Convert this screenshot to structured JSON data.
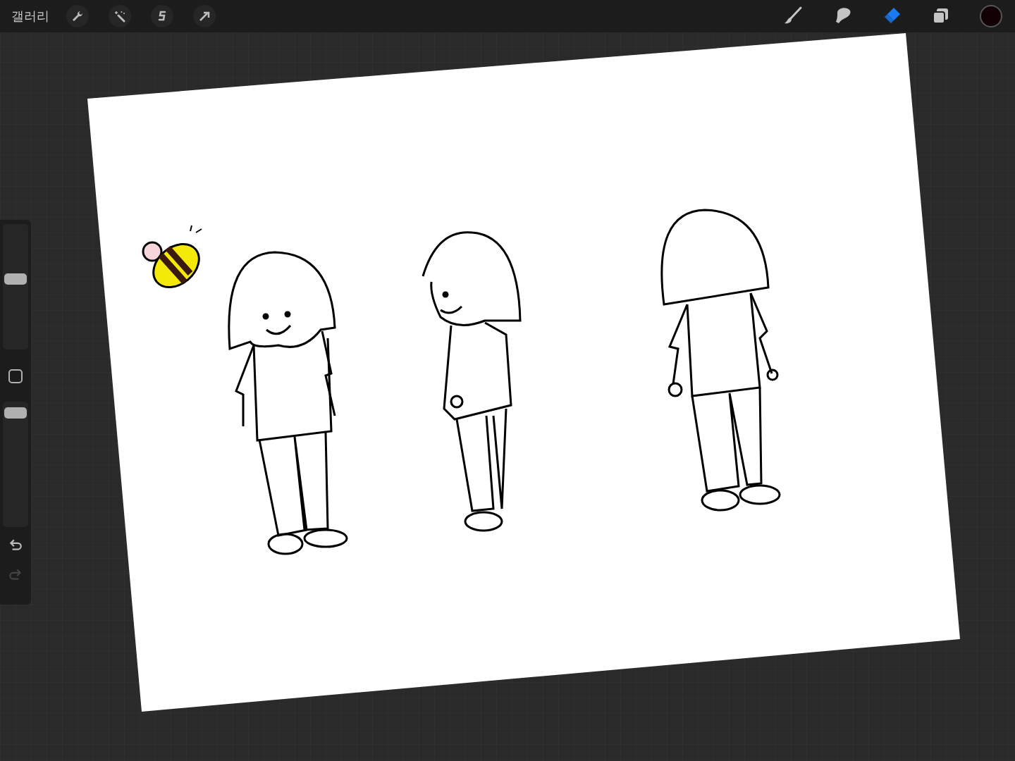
{
  "top_bar": {
    "gallery_label": "갤러리",
    "left_tools": [
      {
        "kind": "wrench"
      },
      {
        "kind": "wand"
      },
      {
        "kind": "selection"
      },
      {
        "kind": "transform"
      }
    ],
    "right_tools": [
      {
        "kind": "brush",
        "selected": false
      },
      {
        "kind": "smudge",
        "selected": false
      },
      {
        "kind": "eraser",
        "selected": true
      },
      {
        "kind": "layers",
        "selected": false
      }
    ],
    "color_swatch": {
      "color": "#120004"
    }
  },
  "sidebar": {
    "size_slider": {
      "level": 0.57
    },
    "opacity_slider": {
      "level": 0.95
    },
    "undo": {
      "disabled": false
    },
    "redo": {
      "disabled": true
    }
  }
}
